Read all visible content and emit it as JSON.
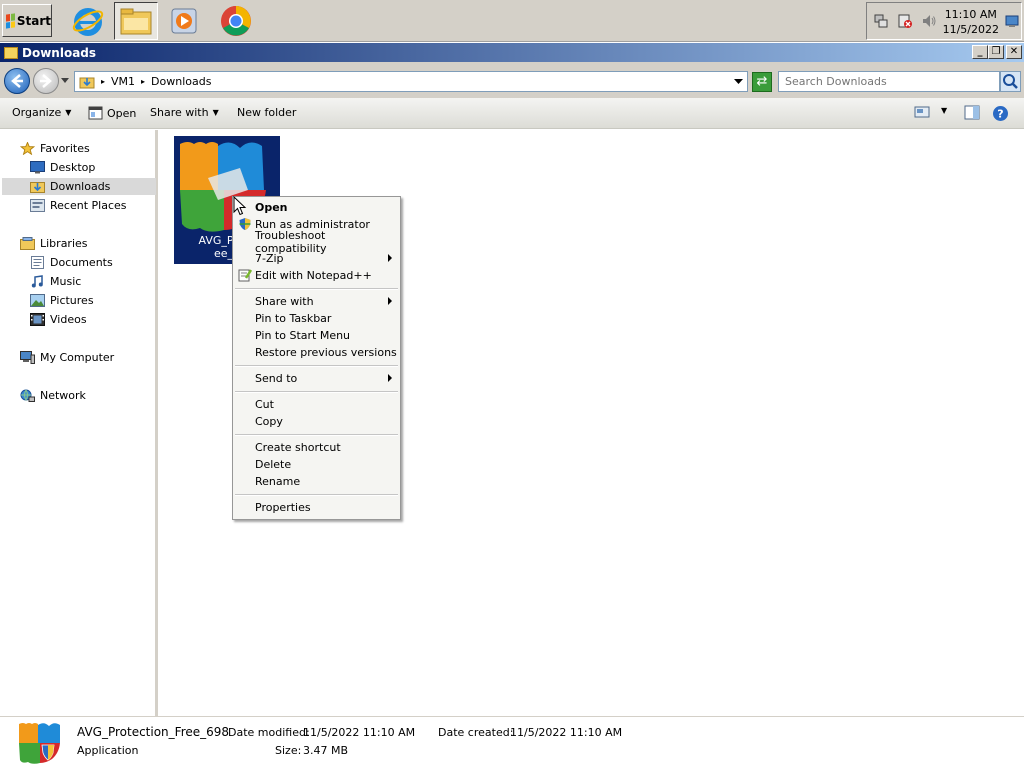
{
  "taskbar": {
    "start_label": "Start",
    "apps": [
      "internet-explorer",
      "windows-explorer",
      "media-player",
      "chrome"
    ],
    "clock_time": "11:10 AM",
    "clock_date": "11/5/2022"
  },
  "window": {
    "title": "Downloads",
    "controls": [
      "_",
      "❐",
      "✕"
    ]
  },
  "address": {
    "path": [
      "VM1",
      "Downloads"
    ],
    "search_placeholder": "Search Downloads"
  },
  "toolbar": {
    "organize": "Organize",
    "open": "Open",
    "share_with": "Share with",
    "new_folder": "New folder"
  },
  "nav": {
    "favorites": "Favorites",
    "desktop": "Desktop",
    "downloads": "Downloads",
    "recent_places": "Recent Places",
    "libraries": "Libraries",
    "documents": "Documents",
    "music": "Music",
    "pictures": "Pictures",
    "videos": "Videos",
    "my_computer": "My Computer",
    "network": "Network"
  },
  "file": {
    "label_line1": "AVG_Prote",
    "label_line2": "ee_6"
  },
  "context_menu": {
    "open": "Open",
    "run_as_admin": "Run as administrator",
    "troubleshoot": "Troubleshoot compatibility",
    "seven_zip": "7-Zip",
    "edit_notepad": "Edit with Notepad++",
    "share_with": "Share with",
    "pin_taskbar": "Pin to Taskbar",
    "pin_start": "Pin to Start Menu",
    "restore_versions": "Restore previous versions",
    "send_to": "Send to",
    "cut": "Cut",
    "copy": "Copy",
    "create_shortcut": "Create shortcut",
    "delete": "Delete",
    "rename": "Rename",
    "properties": "Properties"
  },
  "details": {
    "file_name": "AVG_Protection_Free_698",
    "file_type": "Application",
    "date_modified_label": "Date modified:",
    "date_modified": "11/5/2022 11:10 AM",
    "size_label": "Size:",
    "size": "3.47 MB",
    "date_created_label": "Date created:",
    "date_created": "11/5/2022 11:10 AM"
  },
  "colors": {
    "title_bar": "#0a246a",
    "selection": "#0a246a",
    "taskbar": "#d4d0c8"
  }
}
